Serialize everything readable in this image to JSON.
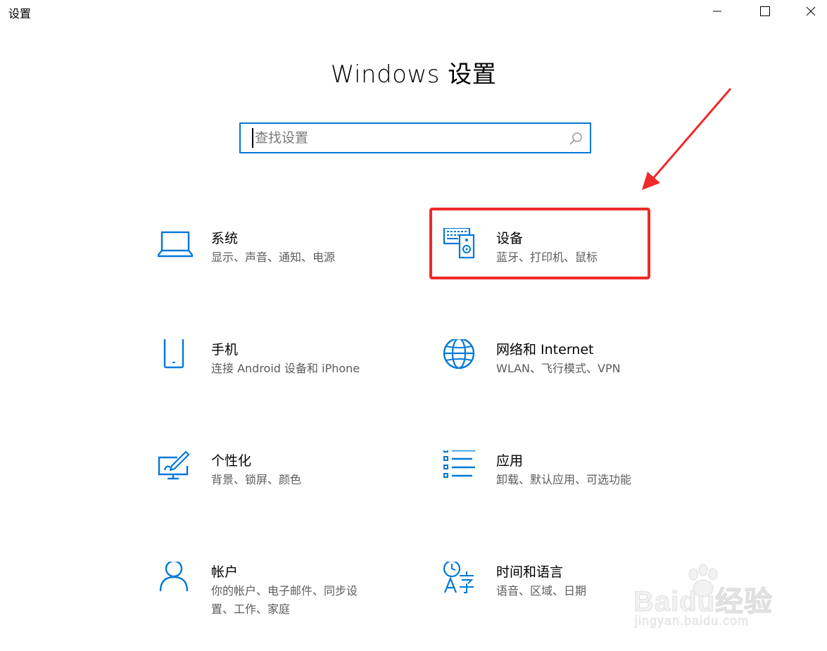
{
  "window": {
    "title": "设置"
  },
  "header": {
    "title": "Windows 设置"
  },
  "search": {
    "placeholder": "查找设置",
    "value": ""
  },
  "tiles": [
    {
      "id": "system",
      "title": "系统",
      "desc": "显示、声音、通知、电源",
      "icon": "laptop-icon"
    },
    {
      "id": "devices",
      "title": "设备",
      "desc": "蓝牙、打印机、鼠标",
      "icon": "devices-icon"
    },
    {
      "id": "phone",
      "title": "手机",
      "desc": "连接 Android 设备和 iPhone",
      "icon": "phone-icon"
    },
    {
      "id": "network",
      "title": "网络和 Internet",
      "desc": "WLAN、飞行模式、VPN",
      "icon": "globe-icon"
    },
    {
      "id": "personalization",
      "title": "个性化",
      "desc": "背景、锁屏、颜色",
      "icon": "paint-icon"
    },
    {
      "id": "apps",
      "title": "应用",
      "desc": "卸载、默认应用、可选功能",
      "icon": "apps-list-icon"
    },
    {
      "id": "accounts",
      "title": "帐户",
      "desc": "你的帐户、电子邮件、同步设\n置、工作、家庭",
      "icon": "person-icon"
    },
    {
      "id": "time-language",
      "title": "时间和语言",
      "desc": "语音、区域、日期",
      "icon": "time-language-icon"
    }
  ],
  "watermark": {
    "brand": "Baidu经验",
    "url": "jingyan.baidu.com"
  },
  "colors": {
    "accent": "#0078d7",
    "highlight": "#ee2a2a",
    "desc_text": "#5c5c5c"
  }
}
